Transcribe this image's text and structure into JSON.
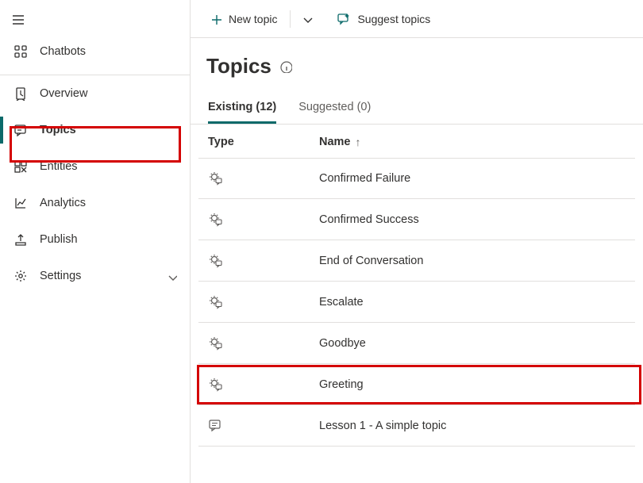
{
  "sidebar": {
    "chatbots_label": "Chatbots",
    "items": [
      {
        "label": "Overview",
        "icon": "overview"
      },
      {
        "label": "Topics",
        "icon": "topics",
        "active": true
      },
      {
        "label": "Entities",
        "icon": "entities"
      },
      {
        "label": "Analytics",
        "icon": "analytics"
      },
      {
        "label": "Publish",
        "icon": "publish"
      },
      {
        "label": "Settings",
        "icon": "settings",
        "chevron": true
      }
    ]
  },
  "commandbar": {
    "new_topic_label": "New topic",
    "suggest_topics_label": "Suggest topics"
  },
  "page": {
    "title": "Topics"
  },
  "tabs": [
    {
      "label": "Existing (12)",
      "active": true
    },
    {
      "label": "Suggested (0)"
    }
  ],
  "columns": {
    "type": "Type",
    "name": "Name",
    "sort_dir": "asc"
  },
  "rows": [
    {
      "name": "Confirmed Failure",
      "type": "system"
    },
    {
      "name": "Confirmed Success",
      "type": "system"
    },
    {
      "name": "End of Conversation",
      "type": "system"
    },
    {
      "name": "Escalate",
      "type": "system"
    },
    {
      "name": "Goodbye",
      "type": "system"
    },
    {
      "name": "Greeting",
      "type": "system",
      "highlight": true
    },
    {
      "name": "Lesson 1 - A simple topic",
      "type": "user"
    }
  ]
}
